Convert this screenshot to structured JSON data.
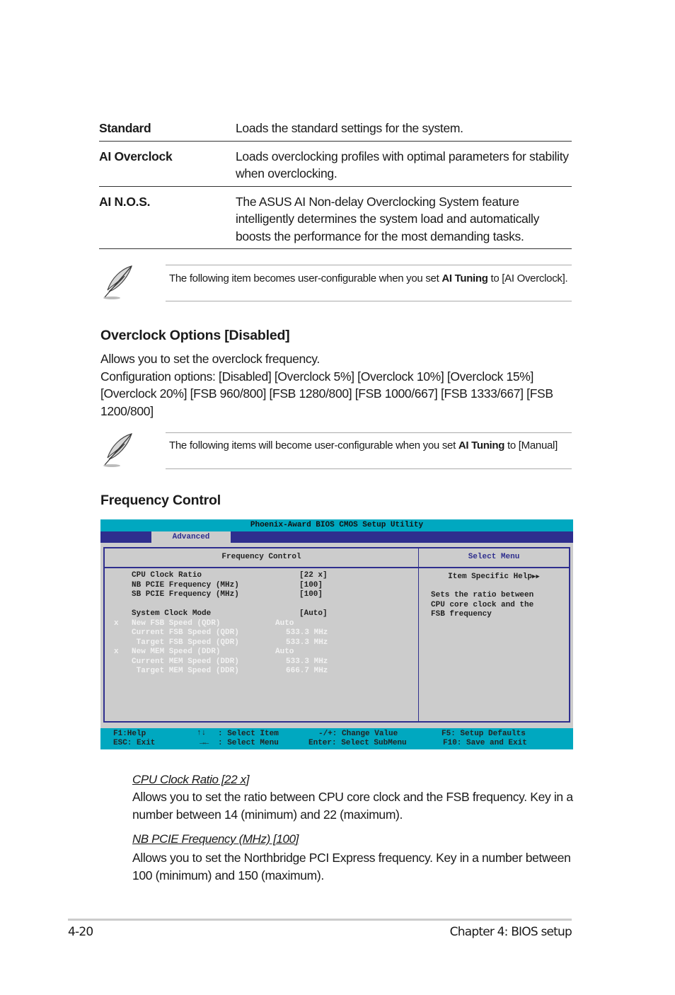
{
  "definitions": [
    {
      "term": "Standard",
      "desc": "Loads the standard settings for the system."
    },
    {
      "term": "AI Overclock",
      "desc": "Loads overclocking profiles with optimal parameters for stability when overclocking."
    },
    {
      "term": "AI N.O.S.",
      "desc": "The ASUS AI Non-delay Overclocking System feature intelligently determines the system load and automatically boosts the performance for the most demanding tasks."
    }
  ],
  "note1": {
    "pre": "The following item becomes user-configurable when you set ",
    "bold": "AI Tuning",
    "post": " to [AI Overclock]."
  },
  "overclock": {
    "heading": "Overclock Options [Disabled]",
    "line1": "Allows you to set the overclock frequency.",
    "line2": "Configuration options: [Disabled] [Overclock 5%] [Overclock 10%] [Overclock 15%] [Overclock 20%] [FSB 960/800] [FSB 1280/800] [FSB 1000/667] [FSB 1333/667] [FSB 1200/800]"
  },
  "note2": {
    "pre": "The following items will become user-configurable when you set ",
    "bold": "AI Tuning",
    "post": " to [Manual]"
  },
  "frequency_heading": "Frequency Control",
  "bios": {
    "title": "Phoenix-Award BIOS CMOS Setup Utility",
    "tab": "Advanced",
    "panel_title": "Frequency Control",
    "side_title": "Select Menu",
    "help_title": "Item Specific Help",
    "help_text": "Sets the ratio between\nCPU core clock and the\nFSB frequency",
    "rows": [
      {
        "mark": "",
        "label": "CPU Clock Ratio",
        "value": "[22 x]",
        "state": "active"
      },
      {
        "mark": "",
        "label": "NB PCIE Frequency (MHz)",
        "value": "[100]",
        "state": "active"
      },
      {
        "mark": "",
        "label": "SB PCIE Frequency (MHz)",
        "value": "[100]",
        "state": "active"
      },
      {
        "mark": "",
        "label": "",
        "value": "",
        "state": "gap"
      },
      {
        "mark": "",
        "label": "System Clock Mode",
        "value": "[Auto]",
        "state": "active"
      },
      {
        "mark": "x",
        "label": "New FSB Speed (QDR)",
        "value": "Auto",
        "state": "dim"
      },
      {
        "mark": "",
        "label": "Current FSB Speed (QDR)",
        "value": "533.3 MHz",
        "state": "dim"
      },
      {
        "mark": "",
        "label": " Target FSB Speed (QDR)",
        "value": "533.3 MHz",
        "state": "dim"
      },
      {
        "mark": "x",
        "label": "New MEM Speed (DDR)",
        "value": "Auto",
        "state": "dim"
      },
      {
        "mark": "",
        "label": "Current MEM Speed (DDR)",
        "value": "533.3 MHz",
        "state": "dim"
      },
      {
        "mark": "",
        "label": " Target MEM Speed (DDR)",
        "value": "666.7 MHz",
        "state": "dim"
      }
    ],
    "footer": {
      "f1": "F1:Help",
      "esc": "ESC: Exit",
      "updown_icon": "↑↓",
      "leftright_icon": "→←",
      "select_item": ": Select Item",
      "select_menu": ": Select Menu",
      "change_value": "-/+: Change Value",
      "enter": "Enter: Select SubMenu",
      "f5": "F5: Setup Defaults",
      "f10": "F10: Save and Exit"
    },
    "colors": {
      "title_bar": "#00a8c0",
      "menu_bar": "#2e2e8e",
      "panel_bg": "#cccccc"
    }
  },
  "items": [
    {
      "title": "CPU Clock Ratio [22 x]",
      "desc": "Allows you to set the ratio between CPU core clock and the FSB frequency. Key in a number between 14 (minimum) and 22 (maximum)."
    },
    {
      "title": "NB PCIE Frequency (MHz) [100]",
      "desc": "Allows you to set the Northbridge PCI Express frequency. Key in a number between 100 (minimum) and 150 (maximum)."
    }
  ],
  "footer": {
    "page": "4-20",
    "chapter": "Chapter 4: BIOS setup"
  }
}
